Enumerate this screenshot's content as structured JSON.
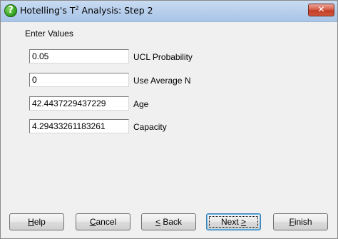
{
  "window": {
    "title_main": "Hotelling's T",
    "title_sup": "2",
    "title_rest": " Analysis: Step 2",
    "app_icon_glyph": "?",
    "close_glyph": "✕",
    "app_icon_name": "question-mark-icon",
    "colors": {
      "titlebar": "#b9d0ec",
      "close_button": "#c23d26",
      "app_icon": "#2f9e1c",
      "window_background": "#f0f0f0"
    }
  },
  "form": {
    "section_label": "Enter Values",
    "fields": [
      {
        "value": "0.05",
        "label": "UCL Probability"
      },
      {
        "value": "0",
        "label": "Use Average N"
      },
      {
        "value": "42.4437229437229",
        "label": "Age"
      },
      {
        "value": "4.29433261183261",
        "label": "Capacity"
      }
    ]
  },
  "buttons": {
    "help": {
      "mnemonic": "H",
      "rest": "elp"
    },
    "cancel": {
      "mnemonic": "C",
      "rest": "ancel"
    },
    "back": {
      "mnemonic": "<",
      "rest": " Back"
    },
    "next": {
      "prefix": "Next ",
      "mnemonic": ">"
    },
    "finish": {
      "mnemonic": "F",
      "rest": "inish"
    }
  }
}
